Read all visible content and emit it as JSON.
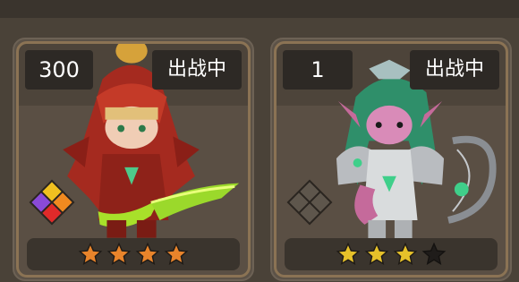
{
  "cards": [
    {
      "level": "300",
      "status": "出战中",
      "stars_filled": 4,
      "stars_total": 4,
      "star_color": "#e8842b",
      "element_badge_icon": "element-diamond-colored-icon",
      "hero_icon": "red-hooded-warrior-icon"
    },
    {
      "level": "1",
      "status": "出战中",
      "stars_filled": 3,
      "stars_total": 4,
      "star_color": "#e6c12a",
      "element_badge_icon": "element-diamond-gray-icon",
      "hero_icon": "green-haired-archer-icon"
    }
  ],
  "colors": {
    "background": "#4a4238",
    "card_frame": "#8b7354",
    "tag_background": "#2d2925",
    "empty_star": "#1f1c1a"
  }
}
